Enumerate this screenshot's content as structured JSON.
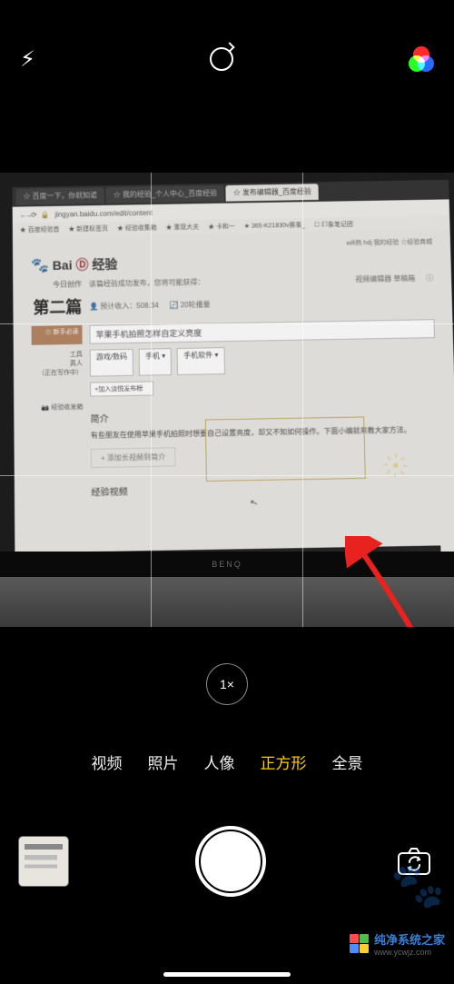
{
  "topbar": {
    "flash_glyph": "⚡︎"
  },
  "viewport": {
    "tabs": {
      "t1": "☆ 百度一下，你就知道",
      "t2": "☆ 我的经验_个人中心_百度经验",
      "t3": "☆ 发布编辑器_百度经验"
    },
    "url": "jingyan.baidu.com/edit/content",
    "bookmarks": {
      "b1": "★ 百度经验首",
      "b2": "★ 新建标签页",
      "b3": "★ 经验收集箱",
      "b4": "★ 重现大夫",
      "b5": "★ 卡和一",
      "b6": "★ 365-K21830v赛事_",
      "b7": "☐ 印象笔记团"
    },
    "toplinks": "wifi热  hdj  我的经验  ☆经验商城",
    "logo_text": "经验",
    "head_line1": "该篇经验成功发布，您将可能获得：",
    "head_right": "视频编辑器  草稿箱",
    "today_label": "今日创作",
    "pian": "第二篇",
    "stat1": "👤 预计收入：508.34",
    "stat2": "🔄 20轮播量",
    "side_new": "☆ 新手必读",
    "side_box": "📷 经验收发箱",
    "side_items": "工具\n真人\n（正在写作中）",
    "title_val": "苹果手机拍照怎样自定义亮度",
    "cat_label": "游戏/数码",
    "sel1": "手机",
    "sel2": "手机软件",
    "add_ph": "+加入淡悦发布标",
    "intro_h": "简介",
    "intro_txt": "有些朋友在使用苹果手机拍照时想要自己设置亮度，却又不知如何操作。下面小编就来教大家方法。",
    "btn_tpl": "+ 添加长视频到简介",
    "vid_h": "经验视频",
    "cursor": "↖",
    "bezel": "BENQ"
  },
  "zoom": "1×",
  "modes": {
    "m1": "视频",
    "m2": "照片",
    "m3": "人像",
    "m4": "正方形",
    "m5": "全景"
  },
  "watermark": {
    "title": "纯净系统之家",
    "sub": "www.ycwjz.com"
  }
}
